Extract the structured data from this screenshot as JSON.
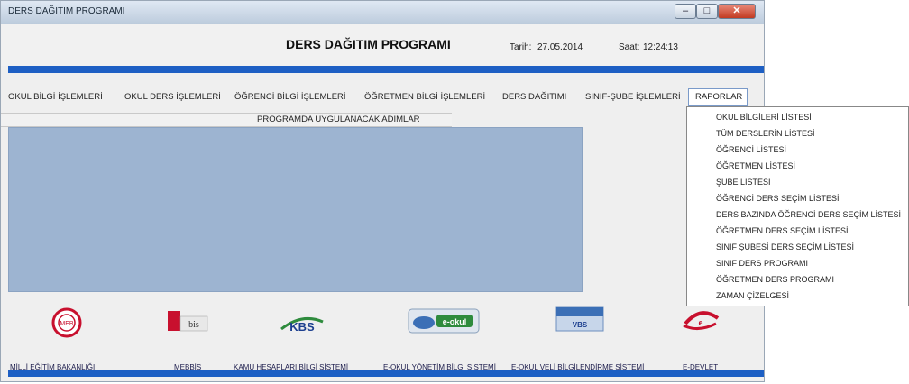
{
  "window": {
    "title": "DERS DAĞITIM PROGRAMI",
    "minimize": "–",
    "maximize": "□",
    "close": "✕"
  },
  "header": {
    "app_title": "DERS DAĞITIM PROGRAMI",
    "date_label": "Tarih:",
    "date_value": "27.05.2014",
    "time_label": "Saat:",
    "time_value": "12:24:13"
  },
  "menu": {
    "items": [
      "OKUL BİLGİ İŞLEMLERİ",
      "OKUL DERS İŞLEMLERİ",
      "ÖĞRENCİ BİLGİ İŞLEMLERİ",
      "ÖĞRETMEN BİLGİ İŞLEMLERİ",
      "DERS DAĞITIMI",
      "SINIF-ŞUBE İŞLEMLERİ",
      "RAPORLAR"
    ],
    "active": "RAPORLAR"
  },
  "reports_menu": [
    "OKUL BİLGİLERİ LİSTESİ",
    "TÜM DERSLERİN LİSTESİ",
    "ÖĞRENCİ LİSTESİ",
    "ÖĞRETMEN LİSTESİ",
    "ŞUBE LİSTESİ",
    "ÖĞRENCİ DERS SEÇİM LİSTESİ",
    "DERS BAZINDA ÖĞRENCİ DERS SEÇİM LİSTESİ",
    "ÖĞRETMEN DERS SEÇİM LİSTESİ",
    "SINIF ŞUBESİ DERS SEÇİM LİSTESİ",
    "SINIF DERS PROGRAMI",
    "ÖĞRETMEN DERS PROGRAMI",
    "ZAMAN ÇİZELGESİ"
  ],
  "steps_panel": {
    "title": "PROGRAMDA UYGULANACAK ADIMLAR"
  },
  "logos": {
    "meb": {
      "text": "MEB",
      "link": "MİLLİ EĞİTİM BAKANLIĞI"
    },
    "mebbis": {
      "text": "bis",
      "link": "MEBBİS"
    },
    "kbs": {
      "text": "KBS",
      "link": "KAMU HESAPLARI BİLGİ SİSTEMİ"
    },
    "eokul": {
      "text": "e-okul",
      "link": "E-OKUL YÖNETİM BİLGİ SİSTEMİ"
    },
    "veli": {
      "text": "VBS",
      "link": "E-OKUL VELİ BİLGİLENDİRME SİSTEMİ"
    },
    "edevlet": {
      "text": "e",
      "link": "E-DEVLET"
    }
  },
  "colors": {
    "accent_band": "#1d5fc4",
    "steps_panel_bg": "#9db4d1",
    "close_button": "#c23b22"
  }
}
